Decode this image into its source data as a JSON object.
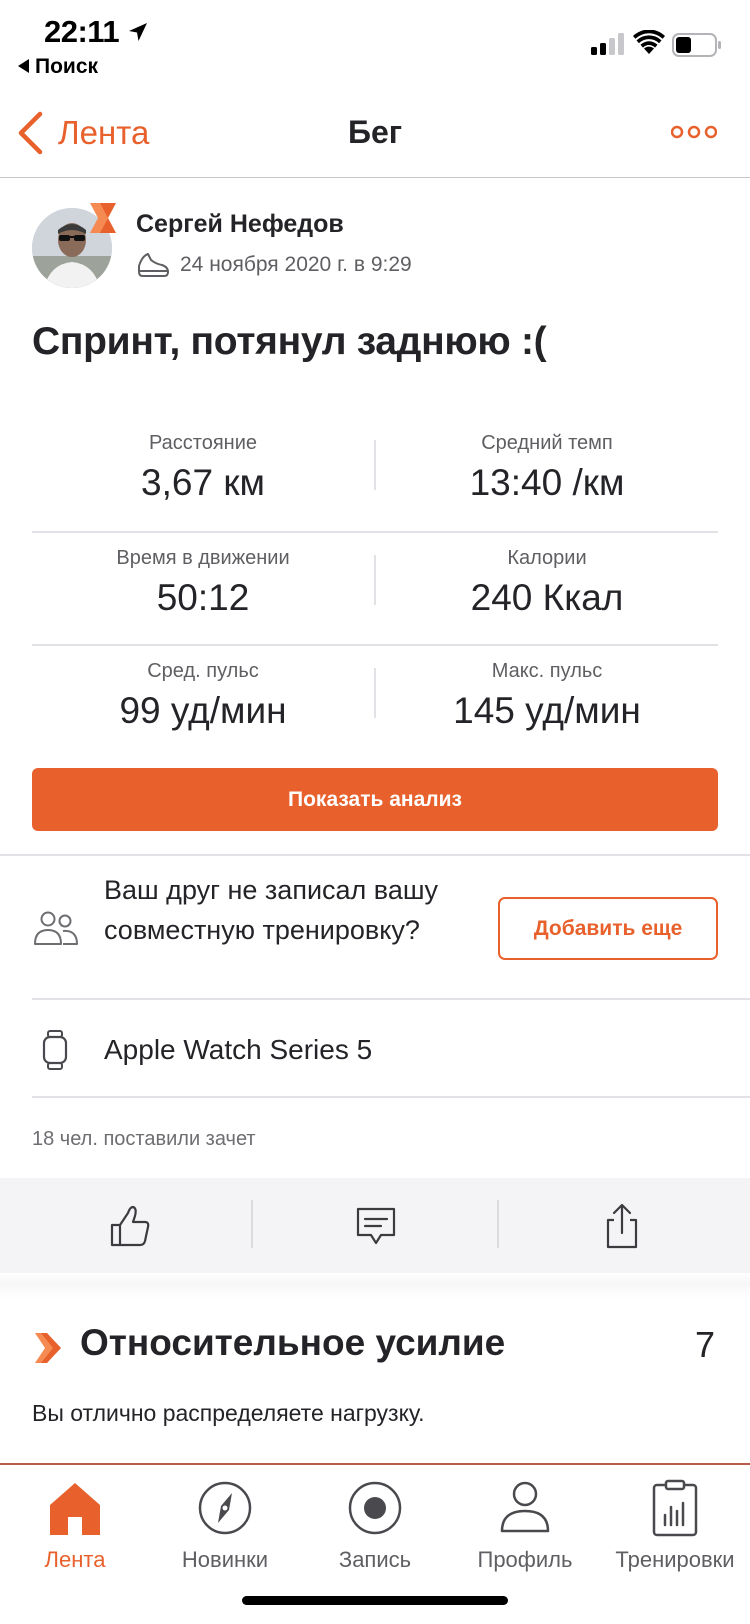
{
  "status_bar": {
    "time": "22:11",
    "back_app_label": "Поиск"
  },
  "nav": {
    "back_label": "Лента",
    "title": "Бег"
  },
  "activity": {
    "athlete_name": "Сергей Нефедов",
    "date": "24 ноября 2020 г. в 9:29",
    "title": "Спринт, потянул заднюю :(",
    "stats": [
      {
        "label": "Расстояние",
        "value": "3,67 км"
      },
      {
        "label": "Средний темп",
        "value": "13:40 /км"
      },
      {
        "label": "Время в движении",
        "value": "50:12"
      },
      {
        "label": "Калории",
        "value": "240 Ккал"
      },
      {
        "label": "Сред. пульс",
        "value": "99 уд/мин"
      },
      {
        "label": "Макс. пульс",
        "value": "145 уд/мин"
      }
    ],
    "analysis_button": "Показать анализ"
  },
  "friend_prompt": {
    "text": "Ваш друг не записал вашу совместную тренировку?",
    "button": "Добавить еще"
  },
  "device": {
    "name": "Apple Watch Series 5"
  },
  "kudos": {
    "text": "18 чел. поставили зачет"
  },
  "actions": [
    {
      "icon": "thumbs-up-icon"
    },
    {
      "icon": "comment-icon"
    },
    {
      "icon": "share-icon"
    }
  ],
  "relative_effort": {
    "title": "Относительное усилие",
    "value": "7",
    "description": "Вы отлично распределяете нагрузку."
  },
  "tabs": [
    {
      "label": "Лента",
      "icon": "home-icon",
      "active": true
    },
    {
      "label": "Новинки",
      "icon": "compass-icon",
      "active": false
    },
    {
      "label": "Запись",
      "icon": "record-icon",
      "active": false
    },
    {
      "label": "Профиль",
      "icon": "profile-icon",
      "active": false
    },
    {
      "label": "Тренировки",
      "icon": "training-log-icon",
      "active": false
    }
  ],
  "colors": {
    "accent": "#e8612c",
    "text": "#242428",
    "secondary_text": "#5f5f63"
  }
}
